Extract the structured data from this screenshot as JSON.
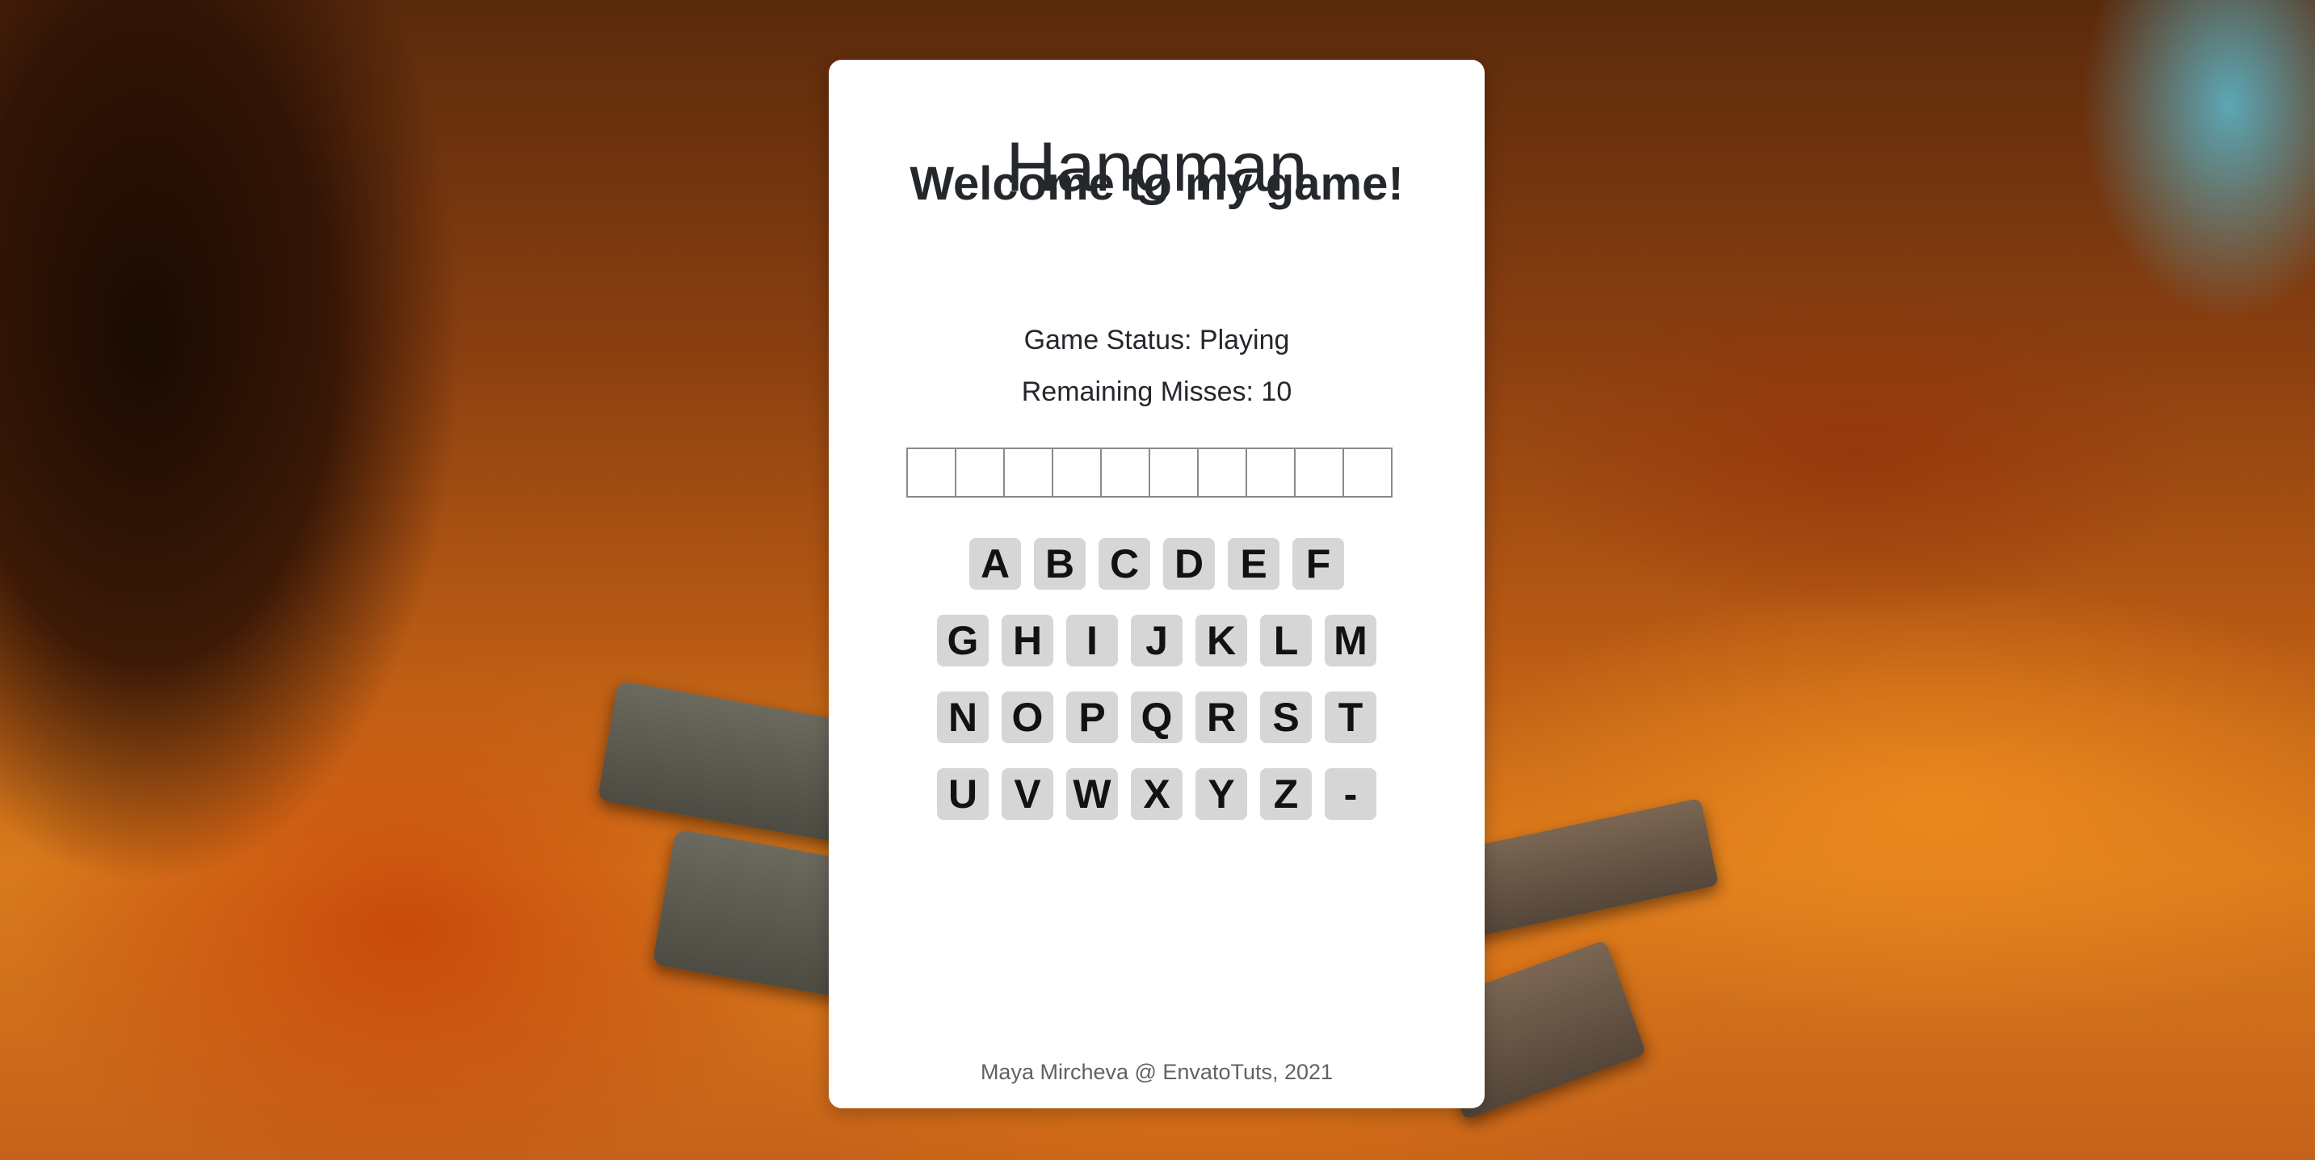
{
  "game": {
    "title": "Hangman",
    "subtitle": "Welcome to my game!",
    "status": "Game Status: Playing",
    "misses": "Remaining Misses: 10",
    "word_length": 10
  },
  "keyboard": {
    "rows": [
      [
        "A",
        "B",
        "C",
        "D",
        "E",
        "F"
      ],
      [
        "G",
        "H",
        "I",
        "J",
        "K",
        "L",
        "M"
      ],
      [
        "N",
        "O",
        "P",
        "Q",
        "R",
        "S",
        "T"
      ],
      [
        "U",
        "V",
        "W",
        "X",
        "Y",
        "Z",
        "-"
      ]
    ]
  },
  "footer": {
    "credit": "Maya Mircheva @ EnvatoTuts, 2021"
  }
}
